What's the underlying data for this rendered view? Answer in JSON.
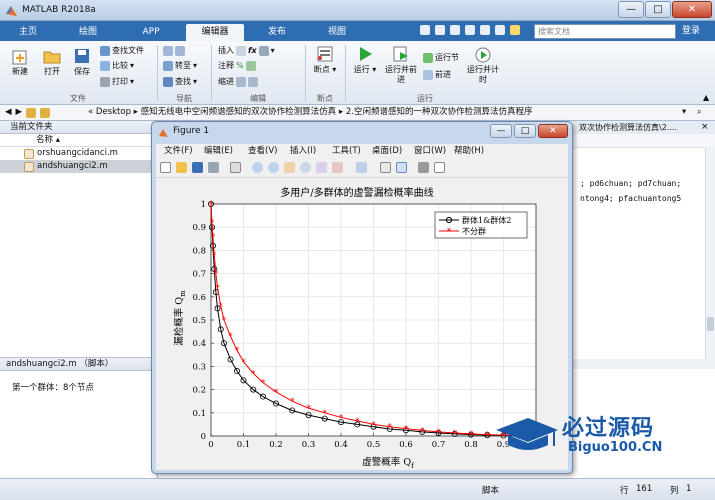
{
  "app": {
    "title": "MATLAB R2018a"
  },
  "window_buttons": {
    "minimize": "—",
    "maximize": "□",
    "close": "✕"
  },
  "tabs": [
    {
      "label": "主页"
    },
    {
      "label": "绘图"
    },
    {
      "label": "APP"
    },
    {
      "label": "编辑器"
    },
    {
      "label": "发布"
    },
    {
      "label": "视图"
    }
  ],
  "search": {
    "placeholder": "搜索文档"
  },
  "login_label": "登录",
  "ribbon": {
    "file": {
      "new": "新建",
      "open": "打开",
      "save": "保存",
      "find_files": "查找文件",
      "compare": "比较",
      "print": "打印",
      "group": "文件"
    },
    "nav": {
      "goto": "转至",
      "find": "查找",
      "group": "导航"
    },
    "edit": {
      "insert": "插入",
      "comment": "注释",
      "indent": "缩进",
      "group": "编辑"
    },
    "breakpoint": {
      "label": "断点",
      "group": "断点"
    },
    "run": {
      "run": "运行",
      "run_advance": "运行并前进",
      "run_section": "运行节",
      "advance": "前进",
      "run_time": "运行并计时",
      "group": "运行"
    }
  },
  "address": {
    "prefix": "«",
    "segments": [
      "Desktop",
      "感知无线电中空闲频谱感知的双次协作检测算法仿真",
      "2.空闲频谱感知的一种双次协作检测算法仿真程序"
    ]
  },
  "current_folder": {
    "title": "当前文件夹",
    "column": "名称",
    "files": [
      {
        "name": "orshuangcidanci.m",
        "selected": false
      },
      {
        "name": "andshuangci2.m",
        "selected": true
      }
    ]
  },
  "details": {
    "title": "andshuangci2.m （脚本）",
    "text": "第一个群体：8个节点"
  },
  "editor": {
    "tab_path": "双次协作检测算法仿真\\2....",
    "code_lines": [
      "; pd6chuan; pd7chuan;",
      "ntong4; pfachuantong5"
    ]
  },
  "status": {
    "type": "脚本",
    "line_label": "行",
    "line": "161",
    "col_label": "列",
    "col": "1"
  },
  "figure": {
    "title": "Figure 1",
    "menu": [
      "文件(F)",
      "编辑(E)",
      "查看(V)",
      "插入(I)",
      "工具(T)",
      "桌面(D)",
      "窗口(W)",
      "帮助(H)"
    ]
  },
  "watermark": {
    "line1": "必过源码",
    "line2": "Biguo100.CN"
  },
  "colors": {
    "accent": "#2f6db3",
    "series1": "#000000",
    "series2": "#ff0000"
  },
  "chart_data": {
    "type": "line",
    "title": "多用户/多群体的虚警漏检概率曲线",
    "xlabel": "虚警概率 Q",
    "xlabel_sub": "f",
    "ylabel": "漏检概率 Q",
    "ylabel_sub": "m",
    "xlim": [
      0,
      1
    ],
    "ylim": [
      0,
      1
    ],
    "xticks": [
      "0",
      "0.1",
      "0.2",
      "0.3",
      "0.4",
      "0.5",
      "0.6",
      "0.7",
      "0.8",
      "0.9",
      "1"
    ],
    "yticks": [
      "0",
      "0.1",
      "0.2",
      "0.3",
      "0.4",
      "0.5",
      "0.6",
      "0.7",
      "0.8",
      "0.9",
      "1"
    ],
    "grid": true,
    "legend_position": "top-right",
    "series": [
      {
        "name": "群体1&群体2",
        "marker": "circle",
        "color": "#000000",
        "x": [
          0,
          0.003,
          0.006,
          0.01,
          0.015,
          0.02,
          0.03,
          0.04,
          0.06,
          0.08,
          0.1,
          0.13,
          0.16,
          0.2,
          0.25,
          0.3,
          0.35,
          0.4,
          0.45,
          0.5,
          0.55,
          0.6,
          0.65,
          0.7,
          0.75,
          0.8,
          0.85,
          0.9,
          0.95
        ],
        "y": [
          1,
          0.9,
          0.82,
          0.72,
          0.62,
          0.55,
          0.46,
          0.4,
          0.33,
          0.28,
          0.24,
          0.2,
          0.17,
          0.14,
          0.11,
          0.09,
          0.075,
          0.06,
          0.05,
          0.04,
          0.03,
          0.025,
          0.018,
          0.013,
          0.009,
          0.006,
          0.004,
          0.002,
          0.001
        ]
      },
      {
        "name": "不分群",
        "marker": "star",
        "color": "#ff0000",
        "x": [
          0,
          0.003,
          0.006,
          0.01,
          0.015,
          0.02,
          0.03,
          0.04,
          0.06,
          0.08,
          0.1,
          0.13,
          0.16,
          0.2,
          0.25,
          0.3,
          0.35,
          0.4,
          0.45,
          0.5,
          0.55,
          0.6,
          0.65,
          0.7,
          0.75,
          0.8,
          0.85,
          0.9,
          0.95
        ],
        "y": [
          1,
          0.92,
          0.86,
          0.78,
          0.7,
          0.64,
          0.56,
          0.5,
          0.43,
          0.37,
          0.32,
          0.27,
          0.23,
          0.19,
          0.15,
          0.12,
          0.1,
          0.08,
          0.065,
          0.05,
          0.04,
          0.032,
          0.024,
          0.018,
          0.013,
          0.009,
          0.006,
          0.004,
          0.002
        ]
      }
    ]
  }
}
